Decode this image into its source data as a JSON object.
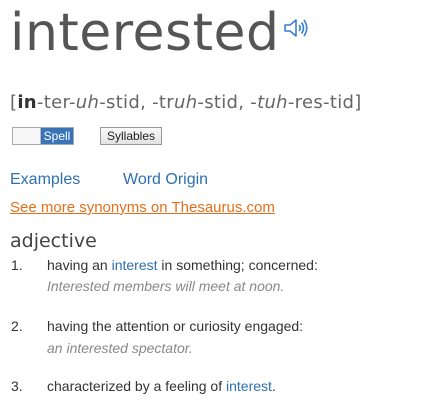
{
  "headword": "interested",
  "speaker_icon": "speaker-icon",
  "pronunciation": {
    "open": "[",
    "stress": "in",
    "rest1": "-ter-",
    "uh": "uh",
    "rest2": "-stid, -tr",
    "uh2": "uh",
    "rest3": "-stid, -",
    "uh3": "tuh",
    "rest4": "-res-tid]"
  },
  "controls": {
    "spell_label": "Spell",
    "syllables_label": "Syllables"
  },
  "links": {
    "examples": "Examples",
    "word_origin": "Word Origin",
    "synonyms": "See more synonyms on Thesaurus.com"
  },
  "part_of_speech": "adjective",
  "definitions": [
    {
      "number": "1.",
      "before": "having an ",
      "link": "interest",
      "after": " in something; concerned:",
      "example": "Interested members will meet at noon."
    },
    {
      "number": "2.",
      "text": "having the attention or curiosity engaged:",
      "example": "an interested spectator."
    },
    {
      "number": "3.",
      "before": "characterized by a feeling of ",
      "link": "interest",
      "after": "."
    }
  ],
  "colors": {
    "link": "#2d6fb2",
    "synonyms_link": "#e36f1d",
    "toggle_on": "#3a74b8"
  }
}
